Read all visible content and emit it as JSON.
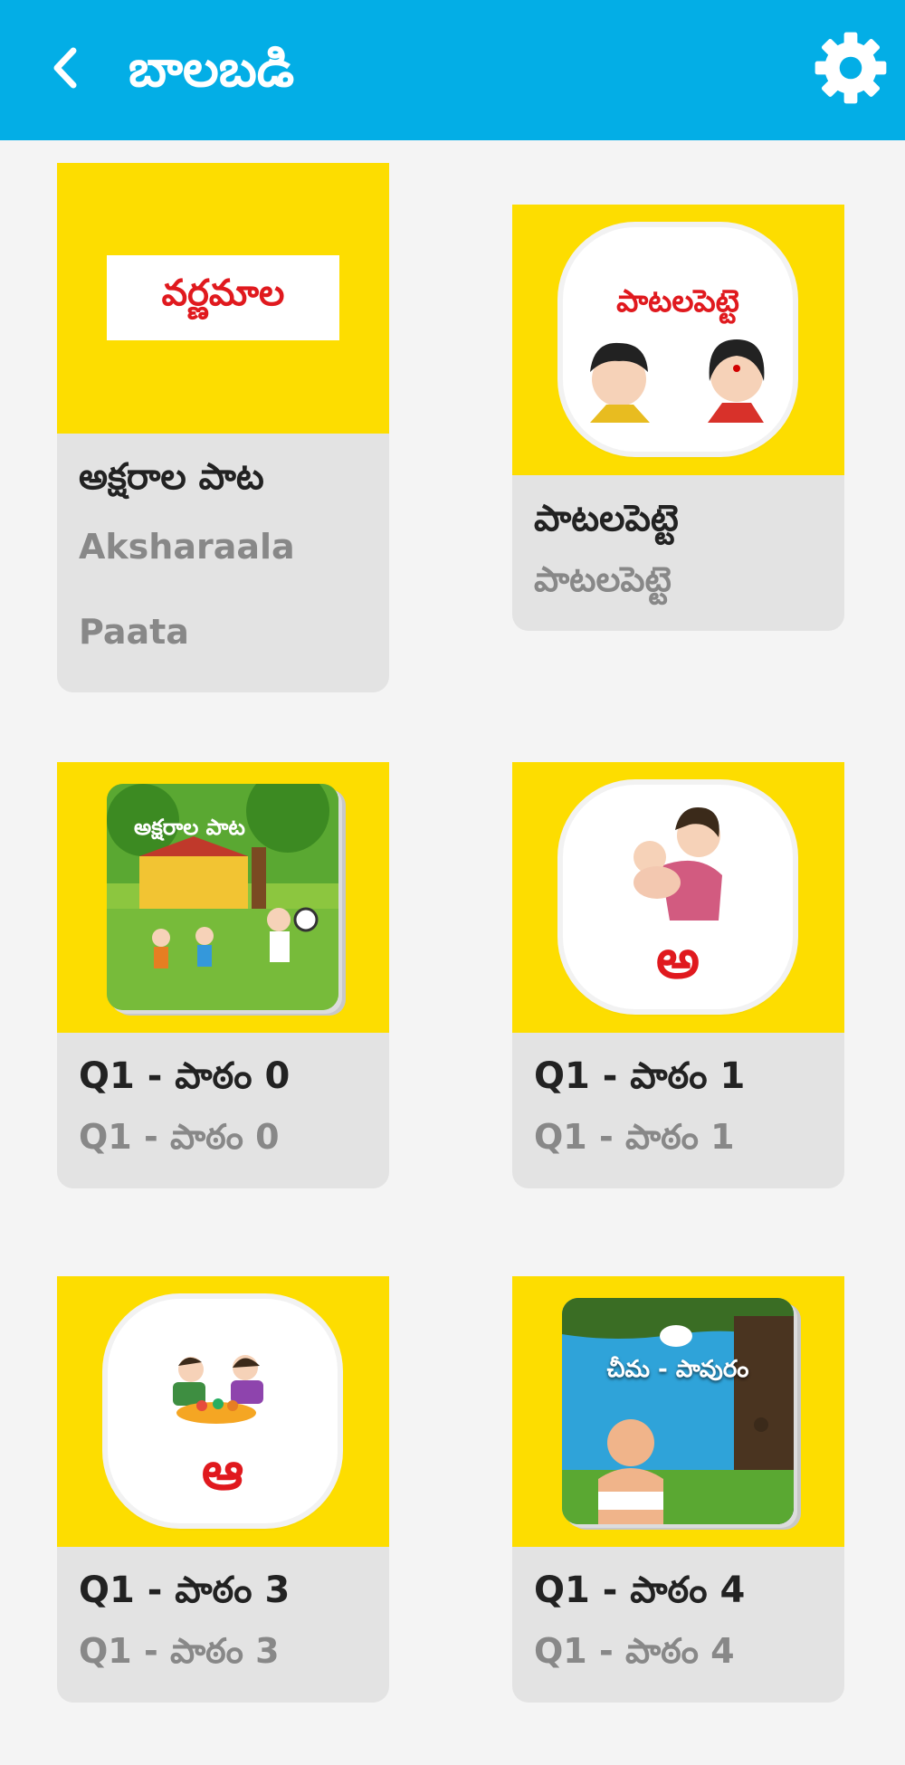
{
  "header": {
    "title": "బాలబడి"
  },
  "cards": [
    {
      "title": "అక్షరాల పాట",
      "subtitle": "Aksharaala Paata",
      "thumb_text": "వర్ణమాల"
    },
    {
      "title": "పాటలపెట్టె",
      "subtitle": "పాటలపెట్టె",
      "thumb_text": "పాటలపెట్టె"
    },
    {
      "title": "Q1 - పాఠం 0",
      "subtitle": "Q1 - పాఠం 0",
      "thumb_text": "అక్షరాల పాట"
    },
    {
      "title": "Q1 - పాఠం 1",
      "subtitle": "Q1 - పాఠం 1",
      "thumb_text": "అ"
    },
    {
      "title": "Q1 - పాఠం 3",
      "subtitle": "Q1 - పాఠం 3",
      "thumb_text": "ఆ"
    },
    {
      "title": "Q1 - పాఠం 4",
      "subtitle": "Q1 - పాఠం 4",
      "thumb_text": "చీమ - పావురం"
    }
  ],
  "colors": {
    "appbar": "#03aee6",
    "thumb_bg": "#fddd00",
    "card_bg": "#e3e3e3",
    "accent_red": "#e0191e"
  },
  "icons": {
    "back": "chevron-left-icon",
    "settings": "gear-icon"
  }
}
